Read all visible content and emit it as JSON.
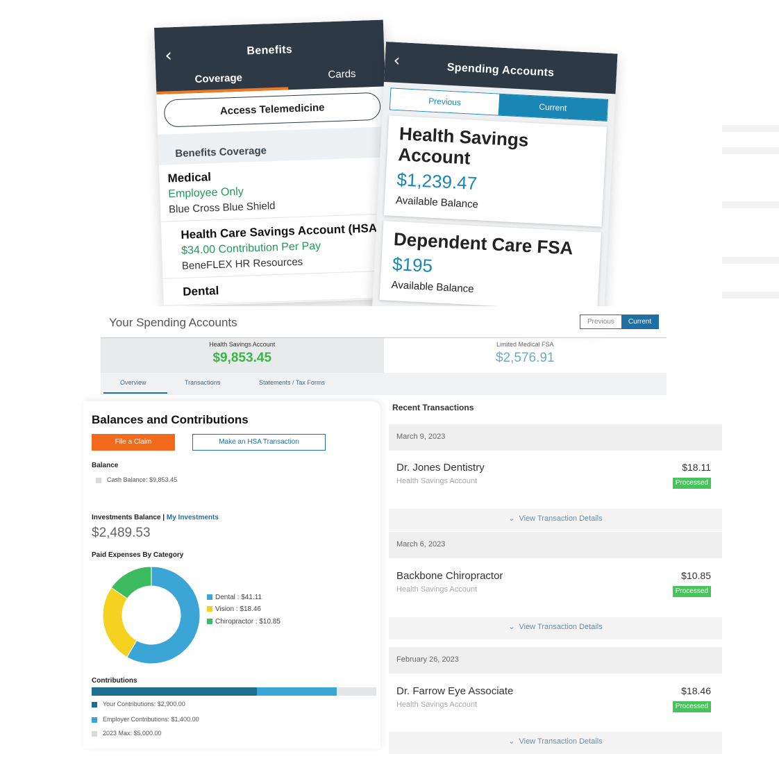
{
  "benefits_app": {
    "title": "Benefits",
    "tabs": [
      "Coverage",
      "Cards"
    ],
    "telemedicine_button": "Access Telemedicine",
    "section_header": "Benefits Coverage",
    "items": [
      {
        "title": "Medical",
        "detail": "Employee Only",
        "provider": "Blue Cross Blue Shield"
      },
      {
        "title": "Health Care Savings Account (HSA)",
        "detail": "$34.00 Contribution Per Pay",
        "provider": "BeneFLEX HR Resources"
      },
      {
        "title": "Dental"
      }
    ]
  },
  "spending_app": {
    "title": "Spending Accounts",
    "toggle": {
      "previous": "Previous",
      "current": "Current"
    },
    "cards": [
      {
        "title": "Health Savings Account",
        "amount": "$1,239.47",
        "label": "Available Balance"
      },
      {
        "title": "Dependent Care FSA",
        "amount": "$195",
        "label": "Available Balance"
      }
    ]
  },
  "desktop": {
    "title": "Your Spending Accounts",
    "toggle": {
      "previous": "Previous",
      "current": "Current"
    },
    "accounts": [
      {
        "name": "Health Savings Account",
        "amount": "$9,853.45"
      },
      {
        "name": "Limited Medical FSA",
        "amount": "$2,576.91"
      }
    ],
    "tabs": [
      "Overview",
      "Transactions",
      "Statements / Tax Forms"
    ]
  },
  "balances": {
    "title": "Balances and Contributions",
    "file_claim": "File a Claim",
    "make_hsa": "Make an HSA Transaction",
    "balance_label": "Balance",
    "cash_balance": "Cash Balance: $9,853.45",
    "investments_label": "Investments Balance",
    "separator": "|",
    "my_investments": "My Investments",
    "investments_value": "$2,489.53",
    "paid_expenses_label": "Paid Expenses By Category",
    "contributions_label": "Contributions",
    "contrib_legend": [
      {
        "label": "Your Contributions: $2,900.00",
        "color": "#1f6f95"
      },
      {
        "label": "Employer Contributions: $1,400.00",
        "color": "#3ba6d6"
      },
      {
        "label": "2023 Max: $5,000.00",
        "color": "#d8d9da"
      }
    ],
    "contributions": {
      "your": 2900,
      "employer": 1400,
      "max": 5000
    }
  },
  "chart_data": {
    "type": "pie",
    "categories": [
      "Dental",
      "Vision",
      "Chiropractor"
    ],
    "values": [
      41.11,
      18.46,
      10.85
    ],
    "legend_labels": [
      "Dental : $41.11",
      "Vision : $18.46",
      "Chiropractor : $10.85"
    ],
    "colors": [
      "#3ba6d6",
      "#f4d21f",
      "#3dbb5f"
    ],
    "legend": "right"
  },
  "transactions": {
    "title": "Recent Transactions",
    "view_details": "View Transaction Details",
    "items": [
      {
        "date": "March 9, 2023",
        "merchant": "Dr. Jones Dentistry",
        "account": "Health Savings Account",
        "amount": "$18.11",
        "status": "Processed"
      },
      {
        "date": "March 6, 2023",
        "merchant": "Backbone Chiropractor",
        "account": "Health Savings Account",
        "amount": "$10.85",
        "status": "Processed"
      },
      {
        "date": "February 26, 2023",
        "merchant": "Dr. Farrow Eye Associate",
        "account": "Health Savings Account",
        "amount": "$18.46",
        "status": "Processed"
      }
    ]
  },
  "colors": {
    "header_dark": "#2d3944",
    "accent_orange": "#f26a1b",
    "accent_blue": "#1f6fa3",
    "success_green": "#46c35a"
  }
}
